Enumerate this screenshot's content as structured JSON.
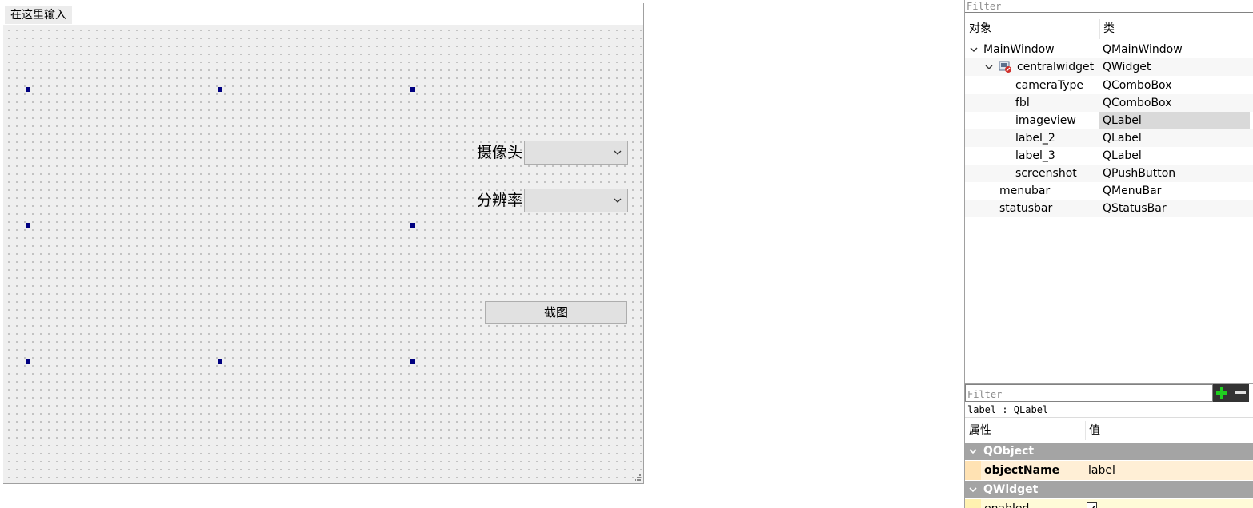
{
  "form": {
    "menubar": {
      "type_here_label": "在这里输入"
    },
    "labels": {
      "camera_label": "摄像头",
      "resolution_label": "分辨率"
    },
    "combos": {
      "camera_value": "",
      "resolution_value": ""
    },
    "buttons": {
      "screenshot_label": "截图"
    }
  },
  "object_inspector": {
    "filter_placeholder": "Filter",
    "columns": {
      "object": "对象",
      "class": "类"
    },
    "rows": [
      {
        "name": "MainWindow",
        "class": "QMainWindow"
      },
      {
        "name": "centralwidget",
        "class": "QWidget"
      },
      {
        "name": "cameraType",
        "class": "QComboBox"
      },
      {
        "name": "fbl",
        "class": "QComboBox"
      },
      {
        "name": "imageview",
        "class": "QLabel"
      },
      {
        "name": "label_2",
        "class": "QLabel"
      },
      {
        "name": "label_3",
        "class": "QLabel"
      },
      {
        "name": "screenshot",
        "class": "QPushButton"
      },
      {
        "name": "menubar",
        "class": "QMenuBar"
      },
      {
        "name": "statusbar",
        "class": "QStatusBar"
      }
    ],
    "selected_row": "imageview"
  },
  "property_editor": {
    "filter_placeholder": "Filter",
    "object_title": "label : QLabel",
    "columns": {
      "property": "属性",
      "value": "值"
    },
    "groups": [
      {
        "label": "QObject"
      },
      {
        "label": "QWidget"
      }
    ],
    "properties": [
      {
        "name": "objectName",
        "value": "label"
      },
      {
        "name": "enabled",
        "value": ""
      }
    ]
  },
  "colors": {
    "handle": "#000080",
    "canvas_bg": "#efefef",
    "group_bg": "#a4a4a4",
    "property_row_bg": "#ffefd6",
    "add_icon": "#1fd01f"
  }
}
